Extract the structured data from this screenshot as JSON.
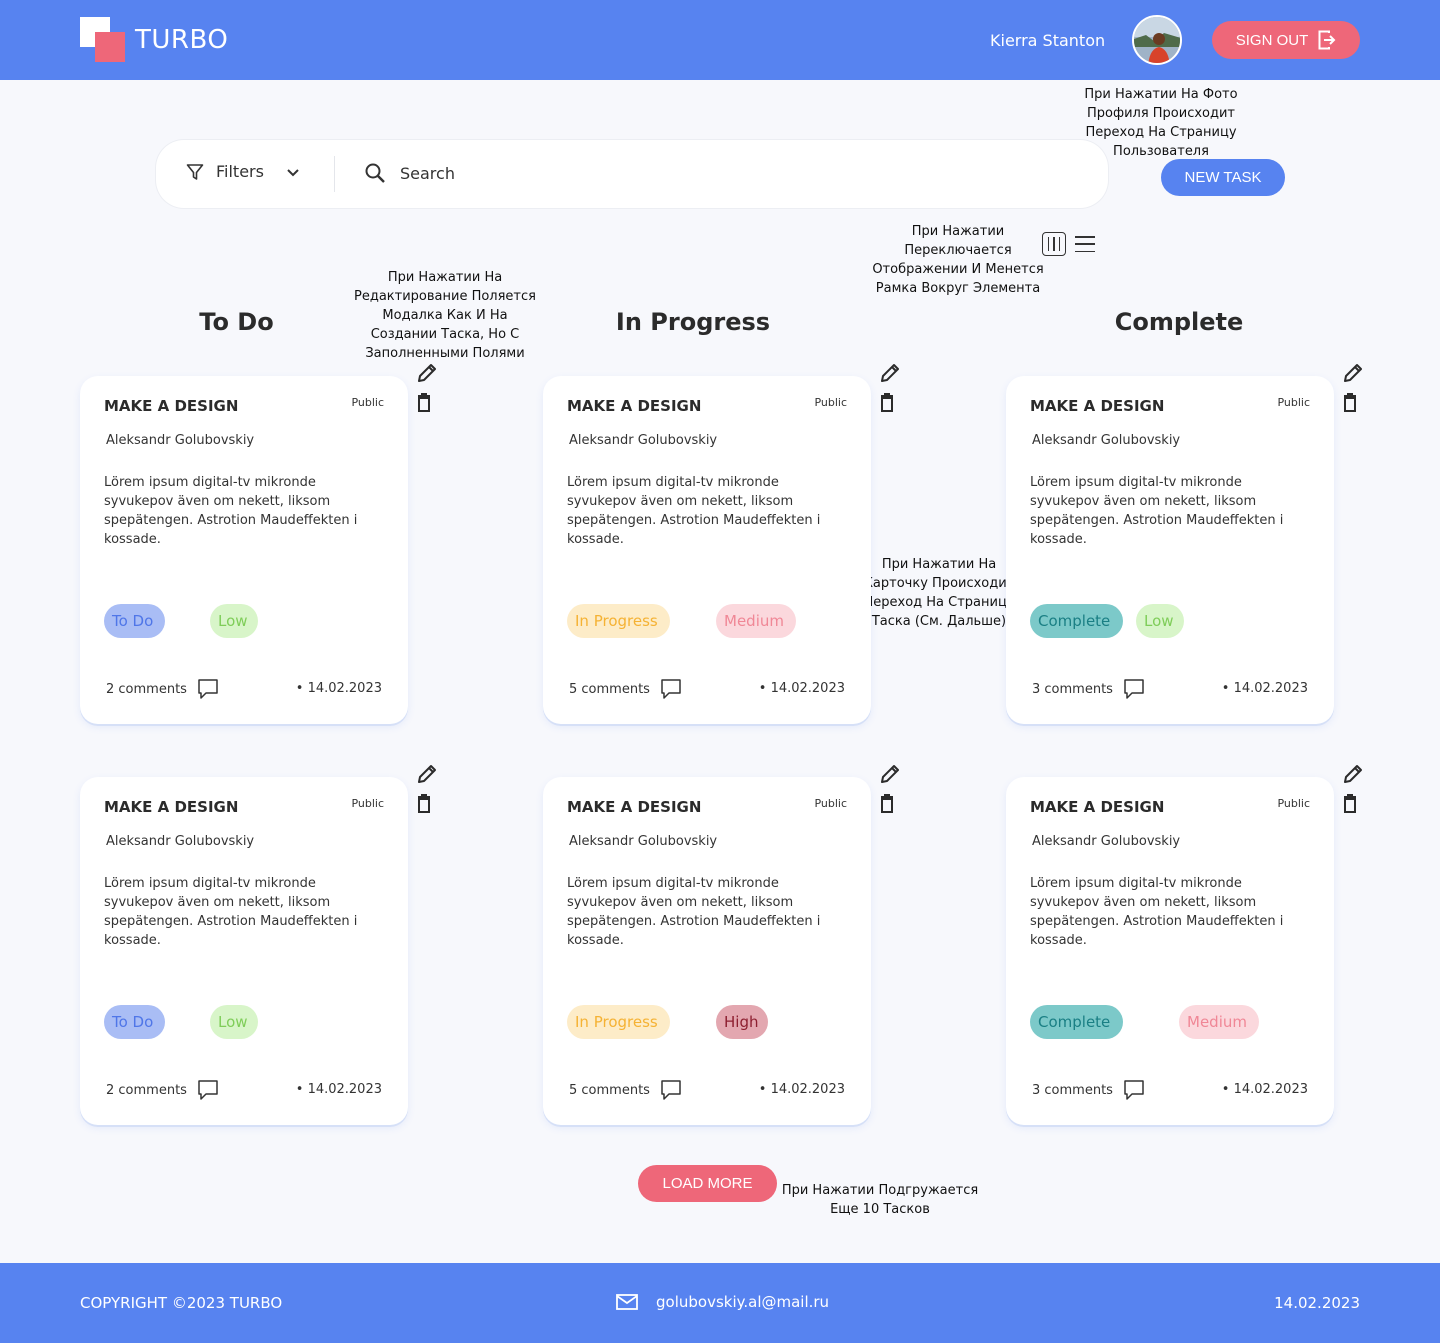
{
  "header": {
    "brand": "TURBO",
    "user_name": "Kierra Stanton",
    "signout_label": "SIGN OUT",
    "color": "#5783f0",
    "accent": "#ee6779"
  },
  "toolbar": {
    "filters_label": "Filters",
    "search_placeholder": "Search",
    "new_task_label": "NEW TASK"
  },
  "notes": {
    "avatar": "При Нажатии На Фото Профиля Происходит Переход На Страницу Пользователя",
    "view_toggle": "При Нажатии Переключается Отображении И Менется Рамка Вокруг Элемента",
    "edit": "При Нажатии На Редактирование Поляется Модалка Как И На Создании Таска, Но С Заполненными Полями",
    "card": "При Нажатии На Карточку Происходит Переход На Страницу Таска (См. Дальше)",
    "load_more": "При Нажатии Подгружается Еще 10 Тасков"
  },
  "columns": [
    {
      "title": "To Do"
    },
    {
      "title": "In Progress"
    },
    {
      "title": "Complete"
    }
  ],
  "cards": [
    {
      "title": "MAKE A DESIGN",
      "visibility": "Public",
      "author": "Aleksandr Golubovskiy",
      "description": "Lörem ipsum digital-tv mikronde syvukepov även om nekett, liksom spepätengen. Astrotion Maudeffekten i kossade.",
      "status": "To Do",
      "priority": "Low",
      "comments": "2 comments",
      "date": "• 14.02.2023"
    },
    {
      "title": "MAKE A DESIGN",
      "visibility": "Public",
      "author": "Aleksandr Golubovskiy",
      "description": "Lörem ipsum digital-tv mikronde syvukepov även om nekett, liksom spepätengen. Astrotion Maudeffekten i kossade.",
      "status": "In Progress",
      "priority": "Medium",
      "comments": "5 comments",
      "date": "• 14.02.2023"
    },
    {
      "title": "MAKE A DESIGN",
      "visibility": "Public",
      "author": "Aleksandr Golubovskiy",
      "description": "Lörem ipsum digital-tv mikronde syvukepov även om nekett, liksom spepätengen. Astrotion Maudeffekten i kossade.",
      "status": "Complete",
      "priority": "Low",
      "comments": "3 comments",
      "date": "• 14.02.2023"
    },
    {
      "title": "MAKE A DESIGN",
      "visibility": "Public",
      "author": "Aleksandr Golubovskiy",
      "description": "Lörem ipsum digital-tv mikronde syvukepov även om nekett, liksom spepätengen. Astrotion Maudeffekten i kossade.",
      "status": "To Do",
      "priority": "Low",
      "comments": "2 comments",
      "date": "• 14.02.2023"
    },
    {
      "title": "MAKE A DESIGN",
      "visibility": "Public",
      "author": "Aleksandr Golubovskiy",
      "description": "Lörem ipsum digital-tv mikronde syvukepov även om nekett, liksom spepätengen. Astrotion Maudeffekten i kossade.",
      "status": "In Progress",
      "priority": "High",
      "comments": "5 comments",
      "date": "• 14.02.2023"
    },
    {
      "title": "MAKE A DESIGN",
      "visibility": "Public",
      "author": "Aleksandr Golubovskiy",
      "description": "Lörem ipsum digital-tv mikronde syvukepov även om nekett, liksom spepätengen. Astrotion Maudeffekten i kossade.",
      "status": "Complete",
      "priority": "Medium",
      "comments": "3 comments",
      "date": "• 14.02.2023"
    }
  ],
  "tag_colors": {
    "To Do": {
      "bg": "#a9bdf5",
      "fg": "#4f76e8"
    },
    "In Progress": {
      "bg": "#fdecc8",
      "fg": "#f5b234"
    },
    "Complete": {
      "bg": "#7cc9c9",
      "fg": "#1a7f84"
    },
    "Low": {
      "bg": "#d8f5c9",
      "fg": "#7fcd59"
    },
    "Medium": {
      "bg": "#fbd8dd",
      "fg": "#f08796"
    },
    "High": {
      "bg": "#e3a7b0",
      "fg": "#8d1f30"
    }
  },
  "load_more_label": "LOAD MORE",
  "footer": {
    "copyright": "COPYRIGHT ©2023 TURBO",
    "email": "golubovskiy.al@mail.ru",
    "date": "14.02.2023"
  }
}
